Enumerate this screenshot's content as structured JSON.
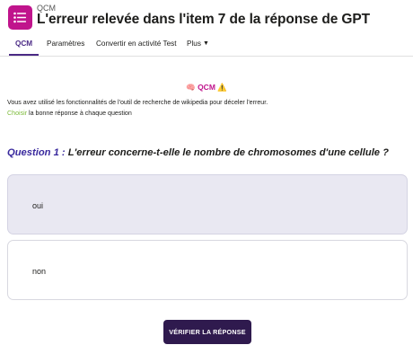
{
  "header": {
    "module_type": "QCM",
    "title": "L'erreur relevée dans l'item 7 de la réponse de GPT",
    "icon": "list-icon",
    "icon_color": "#c0148c"
  },
  "tabs": [
    {
      "label": "QCM",
      "active": true
    },
    {
      "label": "Paramètres",
      "active": false
    },
    {
      "label": "Convertir en activité Test",
      "active": false
    },
    {
      "label": "Plus",
      "active": false
    }
  ],
  "activity": {
    "name": "🧠 QCM ⚠️",
    "description_line1": "Vous avez utilisé les fonctionnalités de l'outil de recherche de wikipedia pour déceler l'erreur.",
    "description_choisir": "Choisir",
    "description_line2_rest": " la bonne réponse à chaque question"
  },
  "question": {
    "label": "Question 1 :",
    "text": " L'erreur concerne-t-elle le nombre de chromosomes d'une cellule ?"
  },
  "answers": [
    {
      "label": "oui",
      "highlighted": true
    },
    {
      "label": "non",
      "highlighted": false
    }
  ],
  "verify_button": "VÉRIFIER LA RÉPONSE",
  "colors": {
    "accent_purple": "#4b2a85",
    "magenta": "#c0148c",
    "green": "#7dbb3a",
    "button_bg": "#2f1a4e"
  }
}
